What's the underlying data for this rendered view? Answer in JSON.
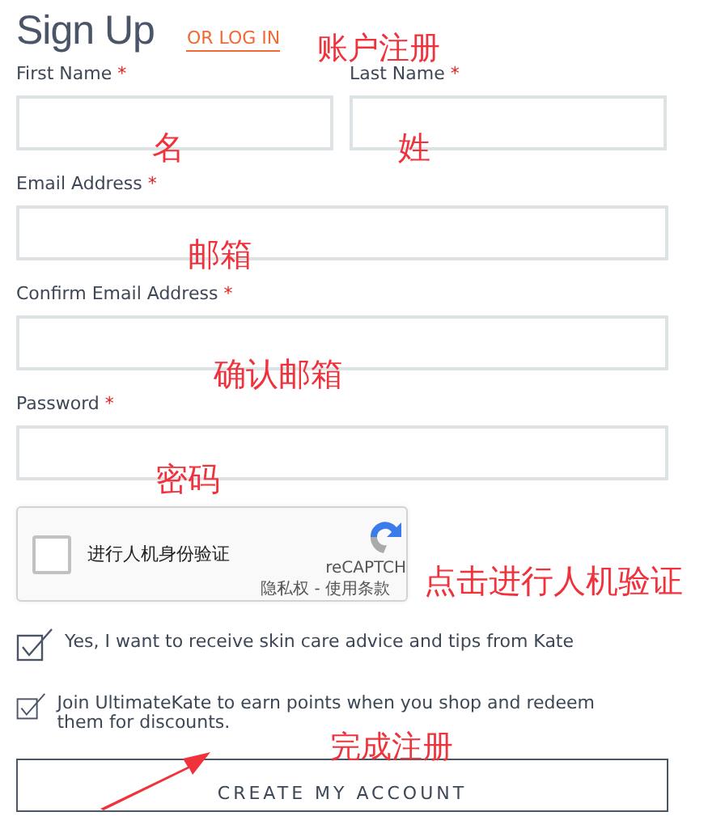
{
  "header": {
    "title": "Sign Up",
    "login_link": "OR LOG IN"
  },
  "name_fields": [
    {
      "label": "First Name",
      "required_mark": "*"
    },
    {
      "label": "Last Name",
      "required_mark": "*"
    }
  ],
  "fields": [
    {
      "label": "Email Address",
      "required_mark": "*"
    },
    {
      "label": "Confirm Email Address",
      "required_mark": "*"
    },
    {
      "label": "Password",
      "required_mark": "*"
    }
  ],
  "captcha": {
    "checked": false,
    "label": "进行人机身份验证",
    "brand": "reCAPTCH",
    "links": "隐私权 - 使用条款"
  },
  "options": [
    {
      "label": "Yes, I want to receive skin care advice and tips from Kate",
      "checked": true
    },
    {
      "label": "Join UltimateKate to earn points when you shop and redeem them for discounts.",
      "checked": true
    }
  ],
  "submit": "CREATE MY ACCOUNT",
  "annotations": [
    {
      "kind": "text",
      "text": "账户注册"
    },
    {
      "kind": "text",
      "text": "名"
    },
    {
      "kind": "text",
      "text": "姓"
    },
    {
      "kind": "text",
      "text": "邮箱"
    },
    {
      "kind": "text",
      "text": "确认邮箱"
    },
    {
      "kind": "text",
      "text": "密码"
    },
    {
      "kind": "text",
      "text": "点击进行人机验证"
    },
    {
      "kind": "text",
      "text": "完成注册"
    },
    {
      "kind": "arrow"
    }
  ]
}
